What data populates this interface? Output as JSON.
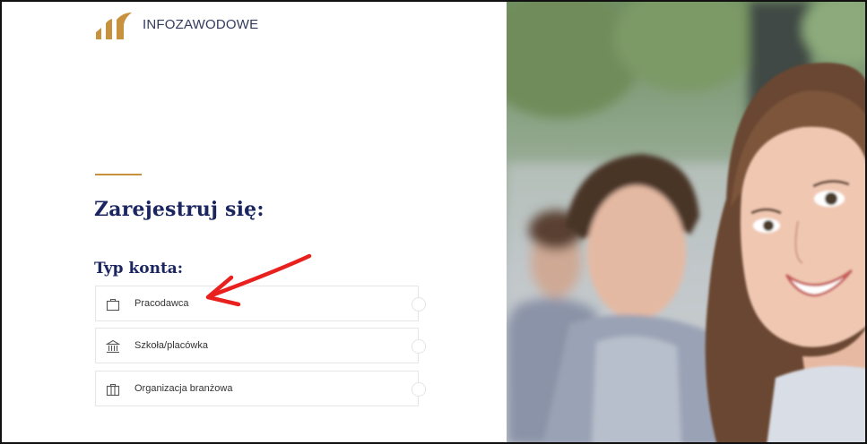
{
  "brand": {
    "name": "INFOZAWODOWE",
    "accent_color": "#c8913e",
    "title_color": "#1b2560"
  },
  "page": {
    "title": "Zarejestruj się:"
  },
  "account_type": {
    "label": "Typ konta:",
    "options": [
      {
        "label": "Pracodawca",
        "icon": "briefcase-icon",
        "selected": false
      },
      {
        "label": "Szkoła/placówka",
        "icon": "school-building-icon",
        "selected": false
      },
      {
        "label": "Organizacja branżowa",
        "icon": "organization-icon",
        "selected": false
      }
    ]
  },
  "annotation": {
    "type": "red-arrow",
    "color": "#e8201e",
    "points_to": "Pracodawca"
  },
  "hero_image": {
    "subject": "students-photo"
  }
}
